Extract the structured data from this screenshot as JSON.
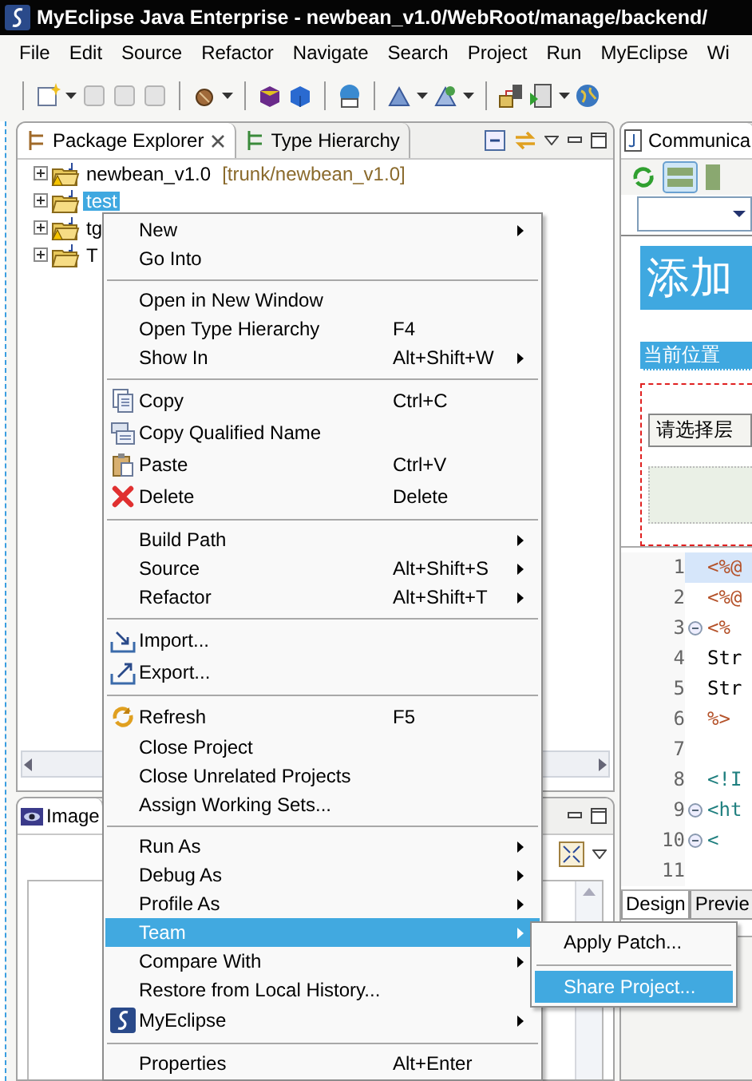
{
  "window": {
    "title": "MyEclipse Java Enterprise - newbean_v1.0/WebRoot/manage/backend/"
  },
  "menu_bar": [
    "File",
    "Edit",
    "Source",
    "Refactor",
    "Navigate",
    "Search",
    "Project",
    "Run",
    "MyEclipse",
    "Wi"
  ],
  "package_explorer": {
    "tabs": [
      {
        "label": "Package Explorer",
        "selected": true
      },
      {
        "label": "Type Hierarchy",
        "selected": false
      }
    ],
    "tree": [
      {
        "name": "newbean_v1.0",
        "detail": "[trunk/newbean_v1.0]",
        "selected": false,
        "expanded": false,
        "warning": true
      },
      {
        "name": "test",
        "selected": true,
        "expanded": false,
        "warning": false
      },
      {
        "name": "tg",
        "selected": false,
        "expanded": false,
        "warning": true
      },
      {
        "name": "T",
        "selected": false,
        "expanded": false,
        "warning": false
      }
    ]
  },
  "image_panel": {
    "tab": "Image"
  },
  "editor": {
    "tab": "Communica",
    "heading": "添加",
    "breadcrumb": "当前位置",
    "select": "请选择层",
    "lines": [
      {
        "number": "1",
        "code": "<%@",
        "color": "#b5532b",
        "foldable": false,
        "current": true
      },
      {
        "number": "2",
        "code": "<%@",
        "color": "#b5532b",
        "foldable": false,
        "current": false
      },
      {
        "number": "3",
        "code": "<%",
        "color": "#b5532b",
        "foldable": true,
        "current": false
      },
      {
        "number": "4",
        "code": "Str",
        "color": "#000000",
        "foldable": false,
        "current": false
      },
      {
        "number": "5",
        "code": "Str",
        "color": "#000000",
        "foldable": false,
        "current": false
      },
      {
        "number": "6",
        "code": "%>",
        "color": "#b5532b",
        "foldable": false,
        "current": false
      },
      {
        "number": "7",
        "foldable": false,
        "current": false
      },
      {
        "number": "8",
        "code": "<!I",
        "color": "#1f7f7f",
        "foldable": false,
        "current": false
      },
      {
        "number": "9",
        "code": "<ht",
        "color": "#1f7f7f",
        "foldable": true,
        "current": false
      },
      {
        "number": "10",
        "code": "<",
        "color": "#1f7f7f",
        "foldable": true,
        "current": false
      },
      {
        "number": "11",
        "foldable": false,
        "current": false
      }
    ],
    "tabs": [
      {
        "label": "Design",
        "selected": true
      },
      {
        "label": "Previe",
        "selected": false
      }
    ]
  },
  "context_menu": [
    {
      "kind": "item",
      "label": "New",
      "submenu": true,
      "selected": false
    },
    {
      "kind": "item",
      "label": "Go Into",
      "submenu": false,
      "selected": false
    },
    {
      "kind": "separator"
    },
    {
      "kind": "item",
      "label": "Open in New Window",
      "submenu": false,
      "selected": false
    },
    {
      "kind": "item",
      "label": "Open Type Hierarchy",
      "shortcut": "F4",
      "submenu": false,
      "selected": false
    },
    {
      "kind": "item",
      "label": "Show In",
      "shortcut": "Alt+Shift+W",
      "submenu": true,
      "selected": false
    },
    {
      "kind": "separator"
    },
    {
      "kind": "item",
      "label": "Copy",
      "shortcut": "Ctrl+C",
      "submenu": false,
      "selected": false
    },
    {
      "kind": "item",
      "label": "Copy Qualified Name",
      "submenu": false,
      "selected": false
    },
    {
      "kind": "item",
      "label": "Paste",
      "shortcut": "Ctrl+V",
      "submenu": false,
      "selected": false
    },
    {
      "kind": "item",
      "label": "Delete",
      "shortcut": "Delete",
      "submenu": false,
      "selected": false
    },
    {
      "kind": "separator"
    },
    {
      "kind": "item",
      "label": "Build Path",
      "submenu": true,
      "selected": false
    },
    {
      "kind": "item",
      "label": "Source",
      "shortcut": "Alt+Shift+S",
      "submenu": true,
      "selected": false
    },
    {
      "kind": "item",
      "label": "Refactor",
      "shortcut": "Alt+Shift+T",
      "submenu": true,
      "selected": false
    },
    {
      "kind": "separator"
    },
    {
      "kind": "item",
      "label": "Import...",
      "submenu": false,
      "selected": false
    },
    {
      "kind": "item",
      "label": "Export...",
      "submenu": false,
      "selected": false
    },
    {
      "kind": "separator"
    },
    {
      "kind": "item",
      "label": "Refresh",
      "shortcut": "F5",
      "submenu": false,
      "selected": false
    },
    {
      "kind": "item",
      "label": "Close Project",
      "submenu": false,
      "selected": false
    },
    {
      "kind": "item",
      "label": "Close Unrelated Projects",
      "submenu": false,
      "selected": false
    },
    {
      "kind": "item",
      "label": "Assign Working Sets...",
      "submenu": false,
      "selected": false
    },
    {
      "kind": "separator"
    },
    {
      "kind": "item",
      "label": "Run As",
      "submenu": true,
      "selected": false
    },
    {
      "kind": "item",
      "label": "Debug As",
      "submenu": true,
      "selected": false
    },
    {
      "kind": "item",
      "label": "Profile As",
      "submenu": true,
      "selected": false
    },
    {
      "kind": "item",
      "label": "Team",
      "submenu": true,
      "selected": true
    },
    {
      "kind": "item",
      "label": "Compare With",
      "submenu": true,
      "selected": false
    },
    {
      "kind": "item",
      "label": "Restore from Local History...",
      "submenu": false,
      "selected": false
    },
    {
      "kind": "item",
      "label": "MyEclipse",
      "submenu": true,
      "selected": false
    },
    {
      "kind": "separator"
    },
    {
      "kind": "item",
      "label": "Properties",
      "shortcut": "Alt+Enter",
      "submenu": false,
      "selected": false
    }
  ],
  "submenu": [
    {
      "kind": "item",
      "label": "Apply Patch...",
      "selected": false
    },
    {
      "kind": "separator"
    },
    {
      "kind": "item",
      "label": "Share Project...",
      "selected": true
    }
  ]
}
